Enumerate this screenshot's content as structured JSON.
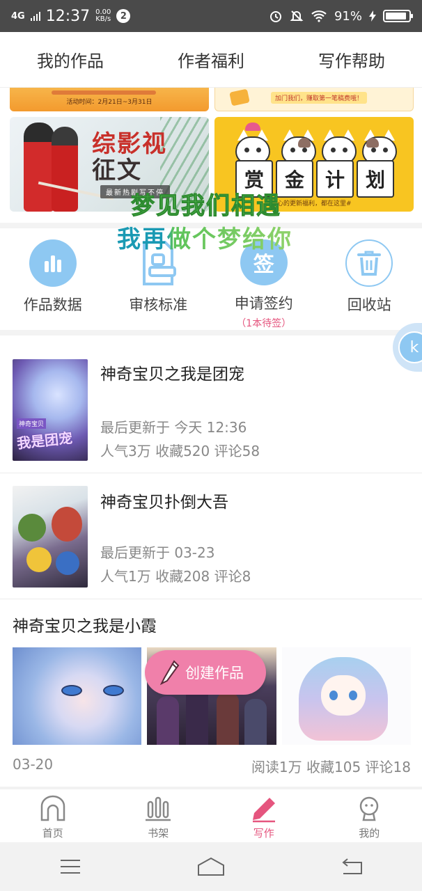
{
  "status_bar": {
    "network": "4G",
    "time": "12:37",
    "speed_value": "0.00",
    "speed_unit": "KB/s",
    "notification_count": "2",
    "battery_percent": "91%",
    "battery_level": 0.91
  },
  "tabs": [
    {
      "label": "我的作品",
      "active": true
    },
    {
      "label": "作者福利",
      "active": false
    },
    {
      "label": "写作帮助",
      "active": false
    }
  ],
  "banners": {
    "top_left_date": "活动时间：2月21日~3月31日",
    "top_right_text": "加门我们，赚取第一笔稿费哦！",
    "left_title_line1": "综影视",
    "left_title_line2": "征文",
    "left_tag": "最新热剧写不停",
    "right_chars": [
      "赏",
      "金",
      "计",
      "划"
    ],
    "right_note": "心的更新福利，都在这里#"
  },
  "overlay": {
    "line1": "梦见我们相遇",
    "line2": "我再做个梦给你"
  },
  "actions": [
    {
      "label": "作品数据",
      "icon": "bar-chart-icon"
    },
    {
      "label": "审核标准",
      "icon": "document-stamp-icon"
    },
    {
      "label": "申请签约",
      "icon": "sign-icon",
      "icon_char": "签",
      "sub": "（1本待签）"
    },
    {
      "label": "回收站",
      "icon": "trash-icon"
    }
  ],
  "floating_button": {
    "icon_char": "k"
  },
  "works": [
    {
      "title": "神奇宝贝之我是团宠",
      "updated": "最后更新于 今天 12:36",
      "stats": "人气3万 收藏520 评论58",
      "cover_text": "我是团宠",
      "cover_badge": "神奇宝贝"
    },
    {
      "title": "神奇宝贝扑倒大吾",
      "updated": "最后更新于 03-23",
      "stats": "人气1万 收藏208 评论8"
    }
  ],
  "work3": {
    "title": "神奇宝贝之我是小霞",
    "date": "03-20",
    "stats": "阅读1万 收藏105 评论18"
  },
  "create_button": {
    "label": "创建作品"
  },
  "bottom_nav": [
    {
      "label": "首页",
      "active": false
    },
    {
      "label": "书架",
      "active": false
    },
    {
      "label": "写作",
      "active": true
    },
    {
      "label": "我的",
      "active": false
    }
  ],
  "colors": {
    "accent": "#e5557e",
    "icon_blue": "#8ec8f2",
    "status_bar": "#4a4a4a"
  }
}
